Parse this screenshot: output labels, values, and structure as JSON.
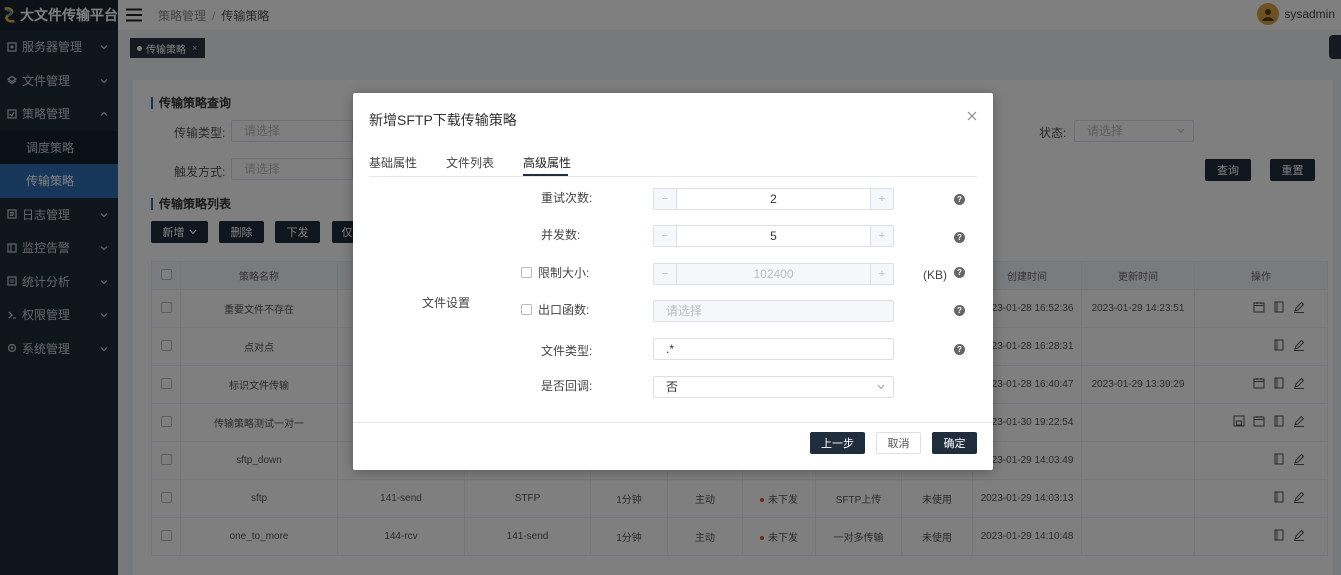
{
  "app": {
    "title": "大文件传输平台"
  },
  "sidebar": {
    "items": [
      {
        "label": "服务器管理",
        "icon": "server-icon"
      },
      {
        "label": "文件管理",
        "icon": "file-icon"
      },
      {
        "label": "策略管理",
        "icon": "strategy-icon"
      }
    ],
    "sub_items": [
      {
        "label": "调度策略"
      },
      {
        "label": "传输策略"
      }
    ],
    "items_after": [
      {
        "label": "日志管理",
        "icon": "log-icon"
      },
      {
        "label": "监控告警",
        "icon": "monitor-icon"
      },
      {
        "label": "统计分析",
        "icon": "chart-icon"
      },
      {
        "label": "权限管理",
        "icon": "permission-icon"
      },
      {
        "label": "系统管理",
        "icon": "settings-icon"
      }
    ]
  },
  "topbar": {
    "breadcrumb": [
      "策略管理",
      "传输策略"
    ],
    "separator": "/",
    "username": "sysadmin"
  },
  "tabs": [
    {
      "label": "传输策略",
      "close": "×"
    }
  ],
  "query": {
    "title": "传输策略查询",
    "type_label": "传输类型:",
    "type_placeholder": "请选择",
    "trigger_label": "触发方式:",
    "trigger_placeholder": "请选择",
    "status_label": "状态:",
    "status_placeholder": "请选择",
    "search_button": "查询",
    "reset_button": "重置"
  },
  "list": {
    "title": "传输策略列表",
    "add_button": "新增",
    "delete_button": "删除",
    "dispatch_button": "下发",
    "more_button": "仅"
  },
  "table": {
    "headers": [
      "策略名称",
      "创建时间",
      "更新时间",
      "操作"
    ],
    "rows": [
      {
        "name": "重要文件不存在",
        "created": "2023-01-28 16:52:36",
        "updated": "2023-01-29 14:23:51"
      },
      {
        "name": "点对点",
        "created": "2023-01-28 16:28:31",
        "updated": ""
      },
      {
        "name": "标识文件传输",
        "created": "2023-01-28 16:40:47",
        "updated": "2023-01-29 13:39:29"
      },
      {
        "name": "传输策略测试一对一",
        "created": "2023-01-30 19:22:54",
        "updated": ""
      },
      {
        "name": "sftp_down",
        "created": "2023-01-29 14:03:49",
        "updated": ""
      },
      {
        "name": "sftp",
        "server": "141-send",
        "protocol": "STFP",
        "interval": "1分钟",
        "trigger": "主动",
        "status": "未下发",
        "type": "SFTP上传",
        "usage": "未使用",
        "created": "2023-01-29 14:03:13",
        "updated": ""
      },
      {
        "name": "one_to_more",
        "server": "144-rcv",
        "protocol": "141-send",
        "interval": "1分钟",
        "trigger": "主动",
        "status": "未下发",
        "type": "一对多传输",
        "usage": "未使用",
        "created": "2023-01-29 14:10:48",
        "updated": ""
      }
    ]
  },
  "dialog": {
    "title": "新增SFTP下载传输策略",
    "tabs": [
      "基础属性",
      "文件列表",
      "高级属性"
    ],
    "active_tab": "高级属性",
    "group_label": "文件设置",
    "retry": {
      "label": "重试次数:",
      "value": "2"
    },
    "concurrency": {
      "label": "并发数:",
      "value": "5"
    },
    "size_limit": {
      "label": "限制大小:",
      "value": "102400",
      "unit": "(KB)"
    },
    "exit_func": {
      "label": "出口函数:",
      "placeholder": "请选择"
    },
    "file_type": {
      "label": "文件类型:",
      "value": ".*"
    },
    "callback": {
      "label": "是否回调:",
      "value": "否"
    },
    "help": "?",
    "minus": "−",
    "plus": "+",
    "prev_button": "上一步",
    "cancel_button": "取消",
    "confirm_button": "确定"
  }
}
